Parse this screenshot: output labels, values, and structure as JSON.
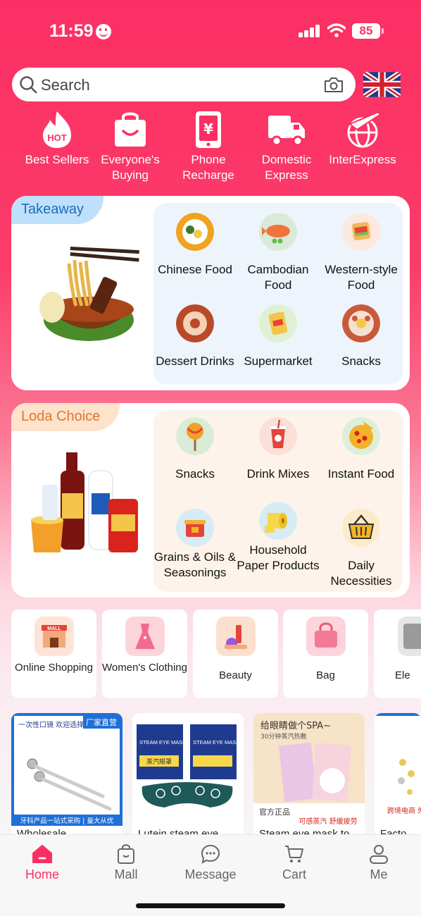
{
  "status_bar": {
    "time": "11:59",
    "battery": "85"
  },
  "search": {
    "placeholder": "Search"
  },
  "quick_nav": [
    {
      "label": "Best Sellers",
      "icon": "hot-fire-icon",
      "badge": "HOT"
    },
    {
      "label": "Everyone's Buying",
      "icon": "shopping-bag-icon"
    },
    {
      "label": "Phone Recharge",
      "icon": "phone-yen-icon"
    },
    {
      "label": "Domestic Express",
      "icon": "truck-icon"
    },
    {
      "label": "InterExpress",
      "icon": "plane-globe-icon"
    }
  ],
  "takeaway": {
    "tag": "Takeaway",
    "items": [
      {
        "label": "Chinese Food",
        "icon": "rice-dish-icon"
      },
      {
        "label": "Cambodian Food",
        "icon": "fish-dish-icon"
      },
      {
        "label": "Western-style Food",
        "icon": "sandwich-icon"
      },
      {
        "label": "Dessert Drinks",
        "icon": "donut-icon"
      },
      {
        "label": "Supermarket",
        "icon": "chips-bag-icon"
      },
      {
        "label": "Snacks",
        "icon": "snack-plate-icon"
      }
    ]
  },
  "loda_choice": {
    "tag": "Loda Choice",
    "items": [
      {
        "label": "Snacks",
        "icon": "lollipop-icon"
      },
      {
        "label": "Drink Mixes",
        "icon": "drink-cup-icon"
      },
      {
        "label": "Instant Food",
        "icon": "pizza-icon"
      },
      {
        "label": "Grains & Oils & Seasonings",
        "icon": "rice-pot-icon"
      },
      {
        "label": "Household Paper Products",
        "icon": "toilet-paper-icon"
      },
      {
        "label": "Daily Necessities",
        "icon": "basket-icon"
      }
    ]
  },
  "categories": [
    {
      "label": "Online Shopping",
      "icon": "mall-store-icon"
    },
    {
      "label": "Women's Clothing",
      "icon": "dress-icon"
    },
    {
      "label": "Beauty",
      "icon": "cosmetics-icon"
    },
    {
      "label": "Bag",
      "icon": "handbag-icon"
    },
    {
      "label": "Ele",
      "icon": "electronics-icon"
    }
  ],
  "products": [
    {
      "title": "Wholesale...",
      "banner_top": "一次性口镜 欢迎选择",
      "badge": "厂家直营",
      "banner_bottom": "牙科产品一站式采购 | 量大从优"
    },
    {
      "title": "Lutein steam eye",
      "pack_label": "STEAM EYE MASK",
      "pack_cn": "蒸汽眼罩"
    },
    {
      "title": "Steam eye mask to",
      "banner_top": "给眼睛做个SPA~",
      "sub": "30分钟蒸汽热敷",
      "badge": "官方正品",
      "banner_bottom": "可感蒸汽 舒缓疲劳"
    },
    {
      "title": "Facto",
      "badge": "跨境电商 外贸代工"
    }
  ],
  "tabbar": [
    {
      "label": "Home",
      "icon": "home-icon",
      "active": true
    },
    {
      "label": "Mall",
      "icon": "mall-bag-icon",
      "active": false
    },
    {
      "label": "Message",
      "icon": "message-bubble-icon",
      "active": false
    },
    {
      "label": "Cart",
      "icon": "cart-icon",
      "active": false
    },
    {
      "label": "Me",
      "icon": "person-icon",
      "active": false
    }
  ],
  "colors": {
    "accent": "#fb2f63",
    "takeaway_tag": "#bfe0fb",
    "loda_tag": "#fde2cc"
  }
}
